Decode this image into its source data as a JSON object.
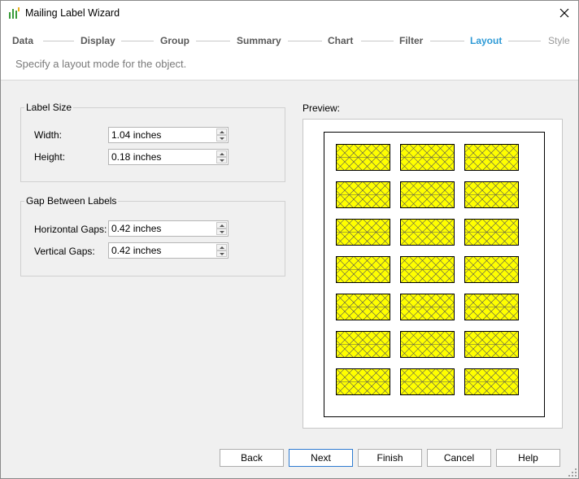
{
  "window": {
    "title": "Mailing Label Wizard"
  },
  "steps": [
    {
      "label": "Data",
      "state": "done"
    },
    {
      "label": "Display",
      "state": "done"
    },
    {
      "label": "Group",
      "state": "done"
    },
    {
      "label": "Summary",
      "state": "done"
    },
    {
      "label": "Chart",
      "state": "done"
    },
    {
      "label": "Filter",
      "state": "done"
    },
    {
      "label": "Layout",
      "state": "active"
    },
    {
      "label": "Style",
      "state": "future"
    }
  ],
  "subtitle": "Specify a layout mode for the object.",
  "label_size": {
    "title": "Label Size",
    "width_label": "Width:",
    "width_value": "1.04 inches",
    "height_label": "Height:",
    "height_value": "0.18 inches"
  },
  "gap": {
    "title": "Gap Between Labels",
    "horizontal_label": "Horizontal Gaps:",
    "horizontal_value": "0.42 inches",
    "vertical_label": "Vertical Gaps:",
    "vertical_value": "0.42 inches"
  },
  "preview": {
    "label": "Preview:",
    "rows": 7,
    "columns": 3,
    "label_fill_color": "#ffff00"
  },
  "buttons": {
    "back": "Back",
    "next": "Next",
    "finish": "Finish",
    "cancel": "Cancel",
    "help": "Help"
  },
  "colors": {
    "active_step": "#2e9ad6",
    "default_button_border": "#2e7bd1"
  }
}
